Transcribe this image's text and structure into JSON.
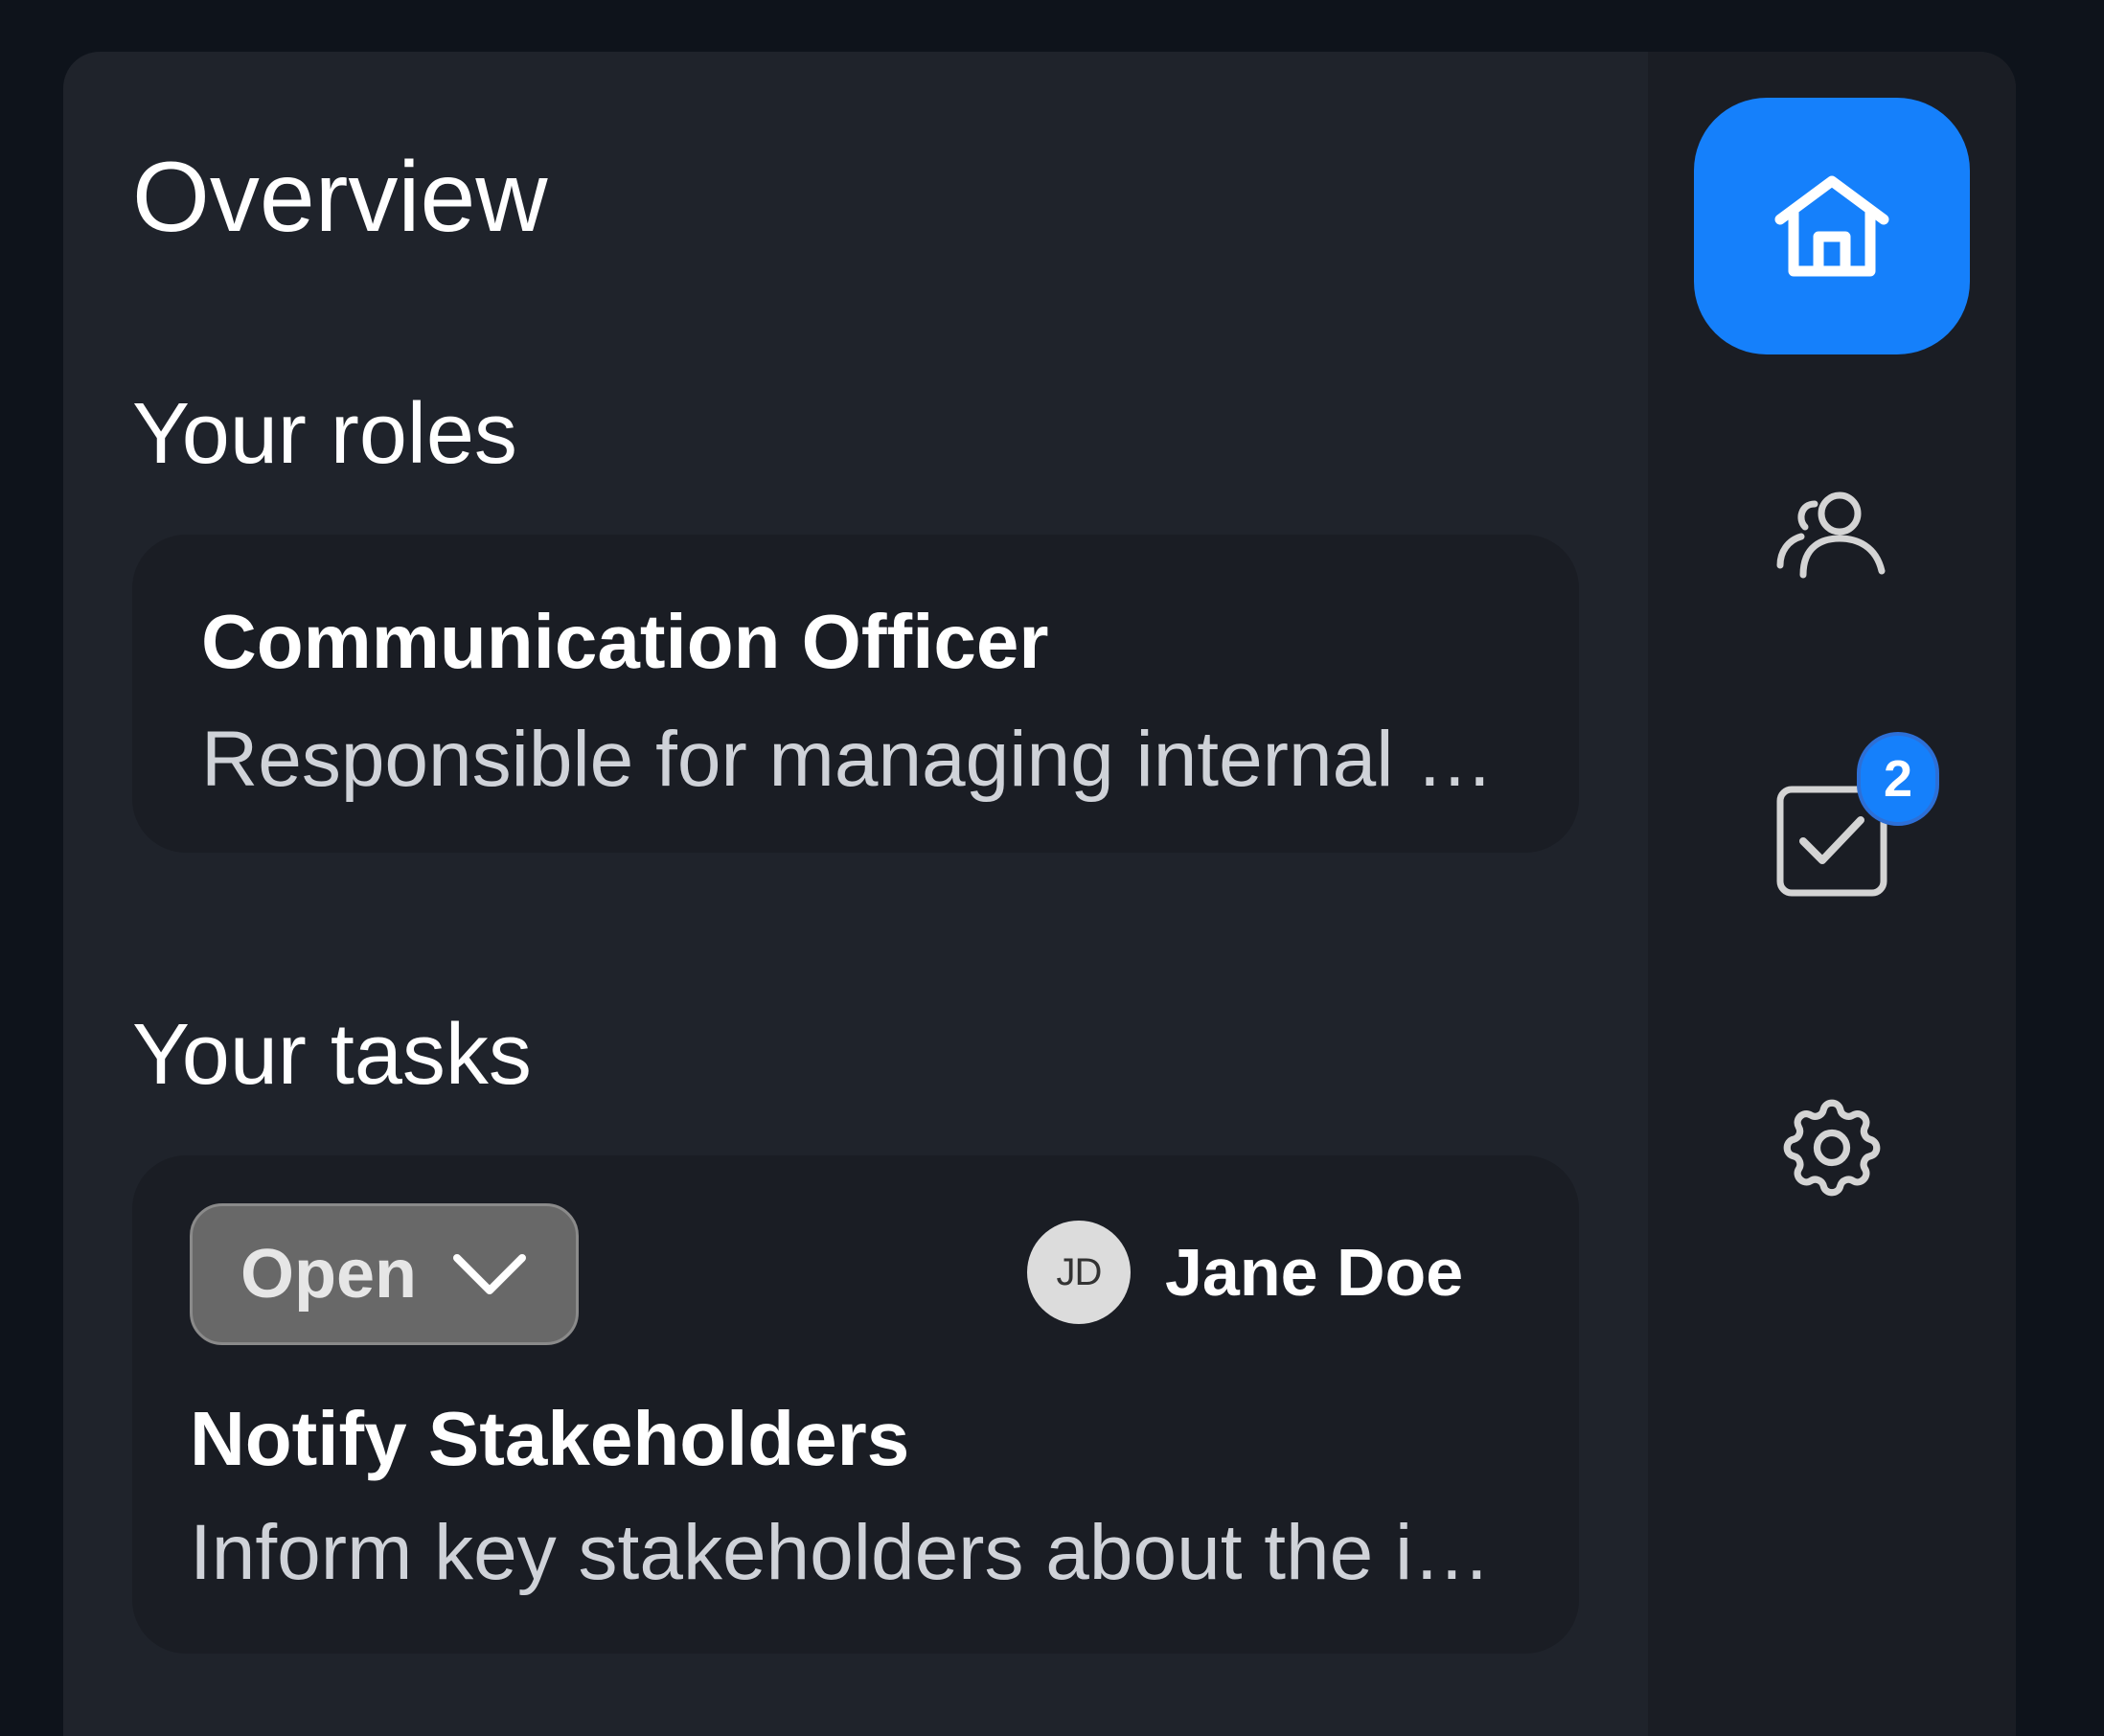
{
  "header": {
    "title": "Overview"
  },
  "roles": {
    "section_title": "Your roles",
    "items": [
      {
        "title": "Communication Officer",
        "description": "Responsible for managing internal communication"
      }
    ]
  },
  "tasks": {
    "section_title": "Your tasks",
    "items": [
      {
        "status": "Open",
        "assignee_initials": "JD",
        "assignee_name": "Jane Doe",
        "title": "Notify Stakeholders",
        "description": "Inform key stakeholders about the incident"
      }
    ]
  },
  "sidebar": {
    "items": [
      {
        "icon": "home-icon",
        "active": true
      },
      {
        "icon": "users-icon",
        "active": false
      },
      {
        "icon": "tasks-icon",
        "active": false,
        "badge": "2"
      },
      {
        "icon": "settings-icon",
        "active": false
      }
    ]
  },
  "colors": {
    "accent": "#1580fb",
    "page_background": "#0e131b",
    "panel_background": "#1f232b",
    "card_background": "#1a1d24",
    "status_background": "#686868"
  }
}
